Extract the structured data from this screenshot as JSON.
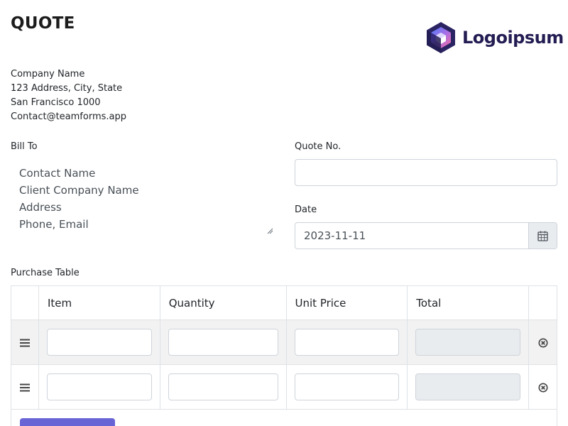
{
  "header": {
    "title": "QUOTE",
    "logo_text": "Logoipsum"
  },
  "company": {
    "name": "Company Name",
    "address": "123 Address, City, State",
    "city": "San Francisco 1000",
    "email": "Contact@teamforms.app"
  },
  "bill_to": {
    "label": "Bill To",
    "placeholder": "Contact Name\nClient Company Name\nAddress\nPhone, Email"
  },
  "quote_no": {
    "label": "Quote No.",
    "value": ""
  },
  "date": {
    "label": "Date",
    "value": "2023-11-11"
  },
  "purchase_table": {
    "label": "Purchase Table",
    "columns": [
      "Item",
      "Quantity",
      "Unit Price",
      "Total"
    ],
    "rows": [
      {
        "item": "",
        "quantity": "",
        "unit_price": "",
        "total": ""
      },
      {
        "item": "",
        "quantity": "",
        "unit_price": "",
        "total": ""
      }
    ]
  },
  "colors": {
    "accent": "#6864d6",
    "logo_text": "#231d53"
  },
  "icons": [
    "drag-handle-icon",
    "remove-row-icon",
    "calendar-icon",
    "textarea-resize-icon",
    "logo-hexagon-icon"
  ]
}
